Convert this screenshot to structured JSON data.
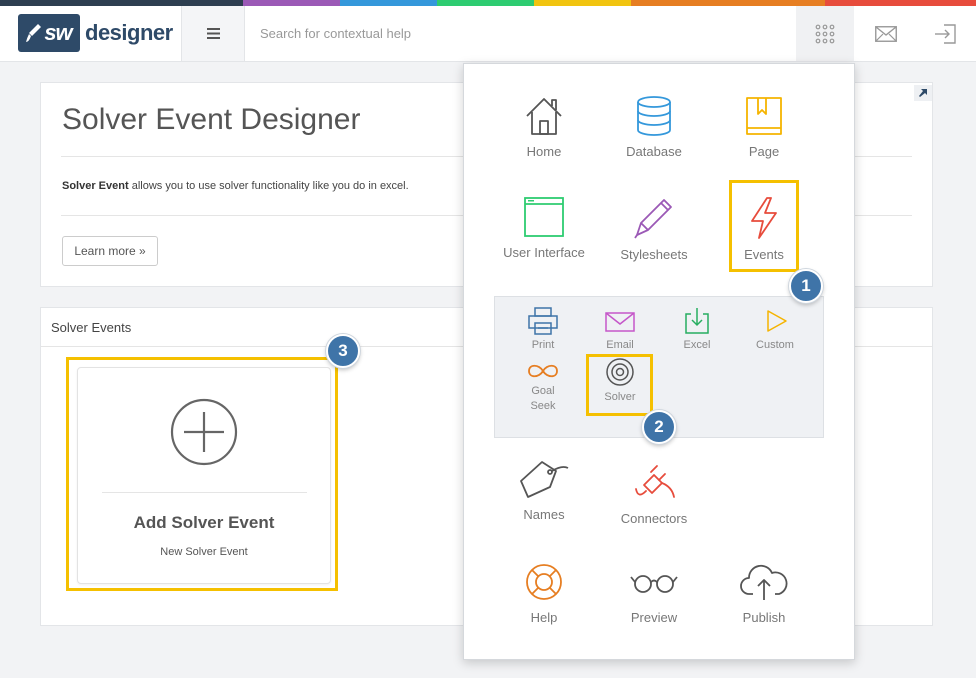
{
  "colors": {
    "strip": [
      "#2d3e50",
      "#9b59b6",
      "#3498db",
      "#2ecc71",
      "#f1c40f",
      "#e67e22",
      "#e74c3c"
    ],
    "highlight": "#f5c000",
    "badge": "#3f74a8",
    "brand": "#2e4a68"
  },
  "header": {
    "logo_mark": "sw",
    "logo_text": "designer",
    "search_placeholder": "Search for contextual help",
    "icons": [
      "menu-icon",
      "apps-grid-icon",
      "mail-icon",
      "sign-in-icon"
    ]
  },
  "intro": {
    "title": "Solver Event Designer",
    "desc_bold": "Solver Event",
    "desc_rest": " allows you to use solver functionality like you do in excel.",
    "learn_more": "Learn more »"
  },
  "events_section": {
    "title": "Solver Events",
    "add_title": "Add Solver Event",
    "add_sub": "New Solver Event"
  },
  "menu": {
    "items": [
      {
        "label": "Home",
        "icon": "home-icon"
      },
      {
        "label": "Database",
        "icon": "database-icon"
      },
      {
        "label": "Page",
        "icon": "page-icon"
      },
      {
        "label": "User Interface",
        "icon": "user-interface-icon"
      },
      {
        "label": "Stylesheets",
        "icon": "stylesheets-icon"
      },
      {
        "label": "Events",
        "icon": "events-icon"
      },
      {
        "label": "Names",
        "icon": "names-icon"
      },
      {
        "label": "Connectors",
        "icon": "connectors-icon"
      },
      {
        "label": "Help",
        "icon": "help-icon"
      },
      {
        "label": "Preview",
        "icon": "preview-icon"
      },
      {
        "label": "Publish",
        "icon": "publish-icon"
      }
    ],
    "sub_items": [
      {
        "label": "Print",
        "icon": "print-icon"
      },
      {
        "label": "Email",
        "icon": "email-icon"
      },
      {
        "label": "Excel",
        "icon": "excel-icon"
      },
      {
        "label": "Custom",
        "icon": "custom-icon"
      },
      {
        "label": "Goal Seek",
        "icon": "goal-seek-icon"
      },
      {
        "label": "Solver",
        "icon": "solver-icon"
      }
    ]
  },
  "badges": [
    "1",
    "2",
    "3"
  ]
}
